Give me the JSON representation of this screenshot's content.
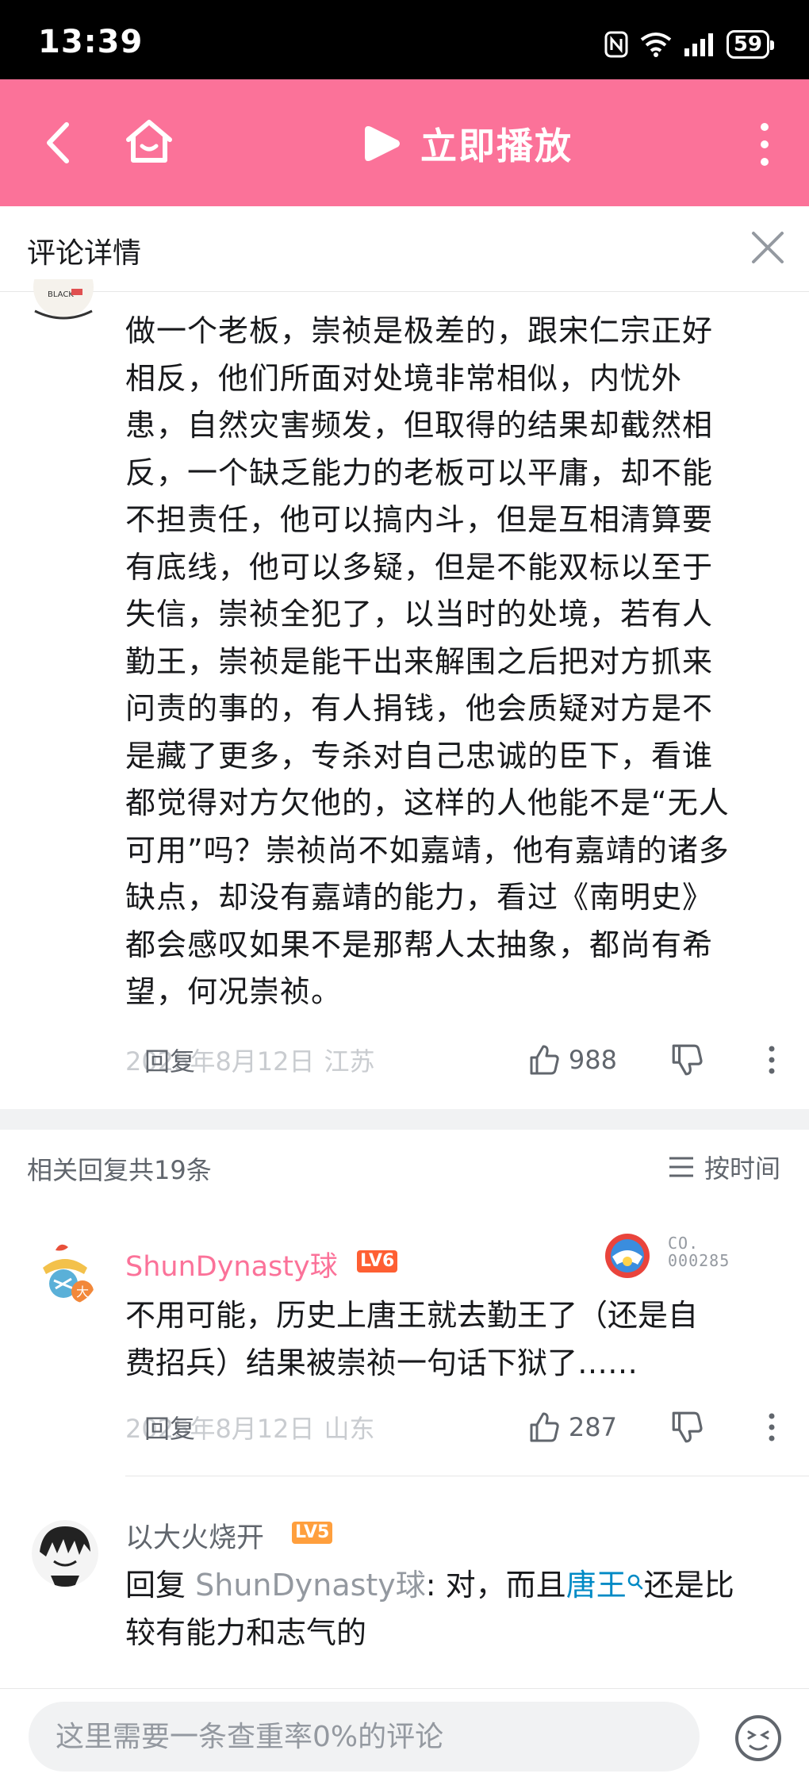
{
  "status_bar": {
    "time": "13:39",
    "battery": "59"
  },
  "top_bar": {
    "play_label": "立即播放"
  },
  "detail_header": {
    "title": "评论详情"
  },
  "main_comment": {
    "avatar_text": "BLACK",
    "lines": [
      "做一个老板，崇祯是极差的，跟宋仁宗正好",
      "相反，他们所面对处境非常相似，内忧外",
      "患，自然灾害频发，但取得的结果却截然相",
      "反，一个缺乏能力的老板可以平庸，却不能",
      "不担责任，他可以搞内斗，但是互相清算要",
      "有底线，他可以多疑，但是不能双标以至于",
      "失信，崇祯全犯了，以当时的处境，若有人",
      "勤王，崇祯是能干出来解围之后把对方抓来",
      "问责的事的，有人捐钱，他会质疑对方是不",
      "是藏了更多，专杀对自己忠诚的臣下，看谁",
      "都觉得对方欠他的，这样的人他能不是“无人",
      "可用”吗？崇祯尚不如嘉靖，他有嘉靖的诸多",
      "缺点，却没有嘉靖的能力，看过《南明史》",
      "都会感叹如果不是那帮人太抽象，都尚有希",
      "望，何况崇祯。"
    ],
    "date": "2025年8月12日",
    "region": "江苏",
    "reply_label": "回复",
    "likes": "988"
  },
  "replies_header": {
    "count": "相关回复共19条",
    "sort": "按时间"
  },
  "replies": [
    {
      "username": "ShunDynasty球",
      "level": "LV6",
      "badge_code_1": "CO.",
      "badge_code_2": "000285",
      "avatar_tag": "大",
      "lines": [
        "不用可能，历史上唐王就去勤王了（还是自",
        "费招兵）结果被崇祯一句话下狱了……"
      ],
      "date": "2025年8月12日",
      "region": "山东",
      "reply_label": "回复",
      "likes": "287"
    },
    {
      "username": "以大火烧开",
      "level": "LV5",
      "reply_prefix": "回复",
      "reply_to": "ShunDynasty球",
      "text_a": ": 对，而且",
      "link": "唐王",
      "text_b": "还是比",
      "line2": "较有能力和志气的"
    }
  ],
  "input_bar": {
    "placeholder": "这里需要一条查重率0%的评论"
  },
  "colors": {
    "brand_pink": "#fb7299",
    "uname_pink": "#fb7299",
    "lv6_red": "#fe5f33",
    "lv5_orange": "#ff9f3d",
    "link_blue": "#008ac5"
  },
  "icons": [
    "back-icon",
    "home-icon",
    "play-icon",
    "more-icon",
    "close-icon",
    "thumb-up-icon",
    "thumb-down-icon",
    "more-dots-icon",
    "sort-icon",
    "emoji-icon",
    "search-icon"
  ]
}
